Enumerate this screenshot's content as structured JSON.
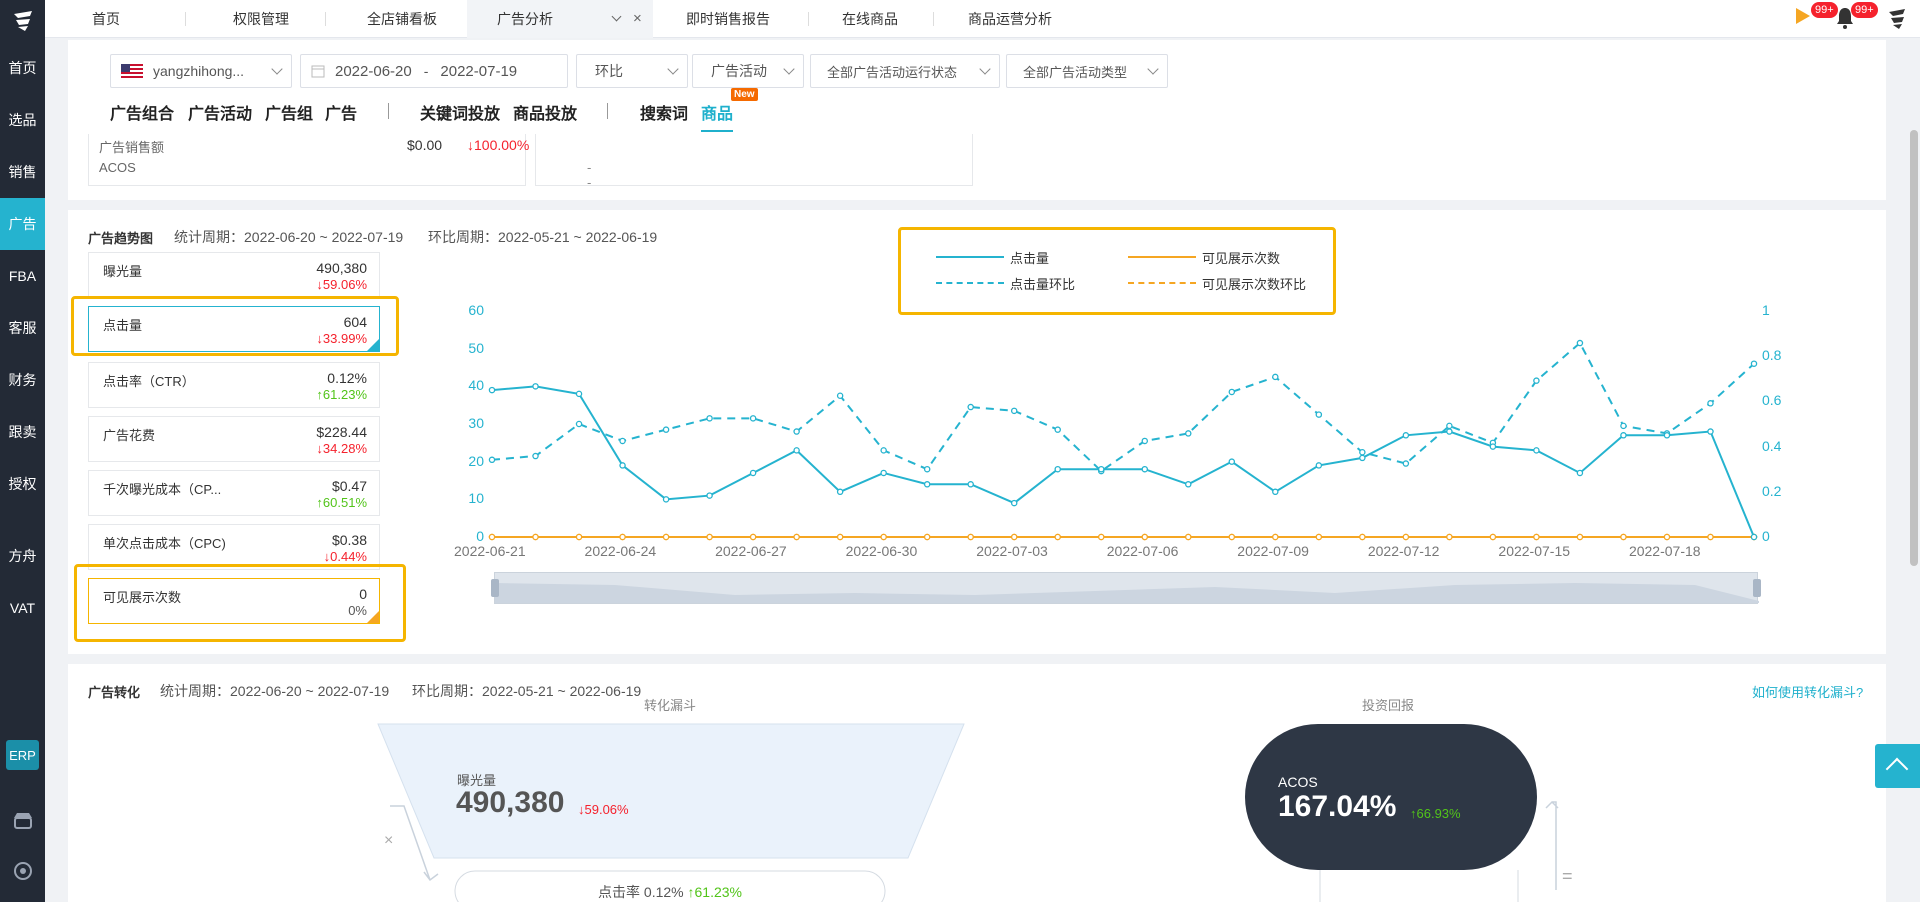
{
  "sidebar": {
    "items": [
      "首页",
      "选品",
      "销售",
      "广告",
      "FBA",
      "客服",
      "财务",
      "跟卖",
      "授权",
      "方舟",
      "VAT"
    ],
    "active_index": 3,
    "erp_label": "ERP"
  },
  "topbar": {
    "tabs": [
      "首页",
      "权限管理",
      "全店铺看板",
      "广告分析",
      "即时销售报告",
      "在线商品",
      "商品运营分析"
    ],
    "active_tab": "广告分析",
    "badge_1": "99+",
    "badge_2": "99+"
  },
  "filters": {
    "store": "yangzhihong...",
    "date_start": "2022-06-20",
    "date_sep": "-",
    "date_end": "2022-07-19",
    "compare": "环比",
    "campaign": "广告活动",
    "campaign_status": "全部广告活动运行状态",
    "campaign_type": "全部广告活动类型"
  },
  "subtabs": {
    "group1": [
      "广告组合",
      "广告活动",
      "广告组",
      "广告"
    ],
    "group2": [
      "关键词投放",
      "商品投放"
    ],
    "group3": [
      "搜索词",
      "商品"
    ],
    "active": "商品",
    "new_badge": "New"
  },
  "summary": {
    "rows": [
      {
        "label": "广告销售额",
        "value": "$0.00",
        "change": "↓100.00%"
      },
      {
        "label": "ACOS",
        "value": "- -",
        "change": ""
      }
    ]
  },
  "trend": {
    "title": "广告趋势图",
    "stat_period": "统计周期：2022-06-20 ~ 2022-07-19",
    "compare_period": "环比周期：2022-05-21 ~ 2022-06-19",
    "metrics": [
      {
        "label": "曝光量",
        "value": "490,380",
        "change": "↓59.06%",
        "dir": "down"
      },
      {
        "label": "点击量",
        "value": "604",
        "change": "↓33.99%",
        "dir": "down"
      },
      {
        "label": "点击率（CTR）",
        "value": "0.12%",
        "change": "↑61.23%",
        "dir": "up"
      },
      {
        "label": "广告花费",
        "value": "$228.44",
        "change": "↓34.28%",
        "dir": "down"
      },
      {
        "label": "千次曝光成本（CP...",
        "value": "$0.47",
        "change": "↑60.51%",
        "dir": "up"
      },
      {
        "label": "单次点击成本（CPC)",
        "value": "$0.38",
        "change": "↓0.44%",
        "dir": "down"
      },
      {
        "label": "可见展示次数",
        "value": "0",
        "change": "0%",
        "dir": "none"
      }
    ],
    "legend": {
      "clicks": "点击量",
      "clicks_prev": "点击量环比",
      "views": "可见展示次数",
      "views_prev": "可见展示次数环比"
    }
  },
  "chart_data": {
    "type": "line",
    "x": [
      "2022-06-21",
      "2022-06-22",
      "2022-06-23",
      "2022-06-24",
      "2022-06-25",
      "2022-06-26",
      "2022-06-27",
      "2022-06-28",
      "2022-06-29",
      "2022-06-30",
      "2022-07-01",
      "2022-07-02",
      "2022-07-03",
      "2022-07-04",
      "2022-07-05",
      "2022-07-06",
      "2022-07-07",
      "2022-07-08",
      "2022-07-09",
      "2022-07-10",
      "2022-07-11",
      "2022-07-12",
      "2022-07-13",
      "2022-07-14",
      "2022-07-15",
      "2022-07-16",
      "2022-07-17",
      "2022-07-18",
      "2022-07-19",
      "2022-07-20"
    ],
    "x_tick_labels": [
      "2022-06-21",
      "2022-06-24",
      "2022-06-27",
      "2022-06-30",
      "2022-07-03",
      "2022-07-06",
      "2022-07-09",
      "2022-07-12",
      "2022-07-15",
      "2022-07-18"
    ],
    "y_left_ticks": [
      0,
      10,
      20,
      30,
      40,
      50,
      60
    ],
    "y_right_ticks": [
      0,
      0.2,
      0.4,
      0.6,
      0.8,
      1
    ],
    "ylim_left": [
      0,
      60
    ],
    "ylim_right": [
      0,
      1
    ],
    "series": [
      {
        "name": "点击量",
        "axis": "left",
        "style": "solid",
        "color": "#25b3cf",
        "values": [
          39,
          40,
          38,
          19,
          10,
          11,
          17,
          23,
          12,
          17,
          14,
          14,
          9,
          18,
          18,
          18,
          14,
          20,
          12,
          19,
          21,
          27,
          28,
          24,
          23,
          17,
          27,
          27,
          28,
          0
        ]
      },
      {
        "name": "点击量环比",
        "axis": "left",
        "style": "dashed",
        "color": "#25b3cf",
        "values": [
          20.5,
          21.5,
          30,
          25.5,
          28.5,
          31.5,
          31.5,
          28,
          37.5,
          23,
          18,
          34.5,
          33.5,
          28.5,
          17.5,
          25.5,
          27.5,
          38.5,
          42.5,
          32.5,
          22.5,
          19.5,
          29.5,
          25,
          41.5,
          51.5,
          29.5,
          27.5,
          35.5,
          46
        ]
      },
      {
        "name": "可见展示次数",
        "axis": "left",
        "style": "solid",
        "color": "#f5a623",
        "values": [
          0,
          0,
          0,
          0,
          0,
          0,
          0,
          0,
          0,
          0,
          0,
          0,
          0,
          0,
          0,
          0,
          0,
          0,
          0,
          0,
          0,
          0,
          0,
          0,
          0,
          0,
          0,
          0,
          0,
          0
        ]
      },
      {
        "name": "可见展示次数环比",
        "axis": "left",
        "style": "dashed",
        "color": "#f5a623",
        "values": [
          0,
          0,
          0,
          0,
          0,
          0,
          0,
          0,
          0,
          0,
          0,
          0,
          0,
          0,
          0,
          0,
          0,
          0,
          0,
          0,
          0,
          0,
          0,
          0,
          0,
          0,
          0,
          0,
          0,
          0
        ]
      }
    ],
    "legend_position": "top-center",
    "grid": false
  },
  "conversion": {
    "title": "广告转化",
    "stat_period": "统计周期：2022-06-20 ~ 2022-07-19",
    "compare_period": "环比周期：2022-05-21 ~ 2022-06-19",
    "funnel_title": "转化漏斗",
    "roi_title": "投资回报",
    "help_link": "如何使用转化漏斗?",
    "impressions_label": "曝光量",
    "impressions_value": "490,380",
    "impressions_change": "↓59.06%",
    "ctr_label": "点击率",
    "ctr_value": "0.12%",
    "ctr_change": "↑61.23%",
    "acos_label": "ACOS",
    "acos_value": "167.04%",
    "acos_change": "↑66.93%",
    "times": "×",
    "equals": "="
  }
}
